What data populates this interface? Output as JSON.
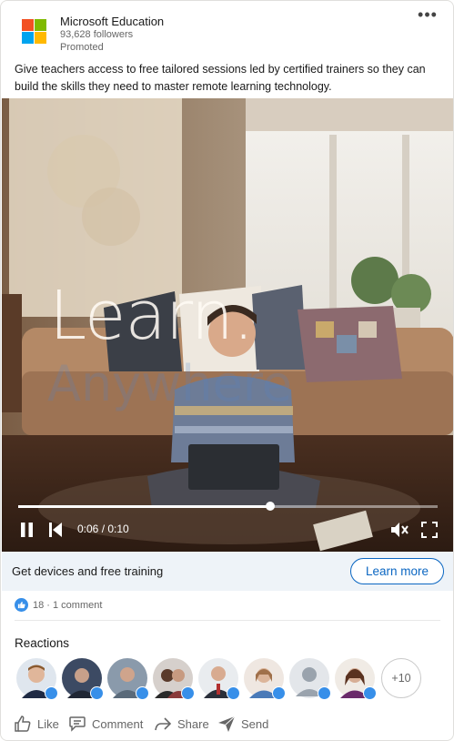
{
  "post": {
    "company": "Microsoft Education",
    "followers": "93,628 followers",
    "promoted": "Promoted",
    "more_label": "•••",
    "text": "Give teachers access to free tailored sessions led by certified trainers so they can build the skills they need to master remote learning technology."
  },
  "video": {
    "overlay_text": "Learn.",
    "ghost_text": "Anywhere",
    "time": "0:06 / 0:10",
    "progress": 0.6
  },
  "cta": {
    "text": "Get devices and free training",
    "button": "Learn more"
  },
  "social": {
    "counts": "18 · 1 comment",
    "reactions_title": "Reactions",
    "more_reactors": "+10"
  },
  "actions": {
    "like": "Like",
    "comment": "Comment",
    "share": "Share",
    "send": "Send"
  },
  "colors": {
    "brand_blue": "#0a66c2",
    "like_blue": "#378fe9",
    "cta_bg": "#eef3f8"
  }
}
